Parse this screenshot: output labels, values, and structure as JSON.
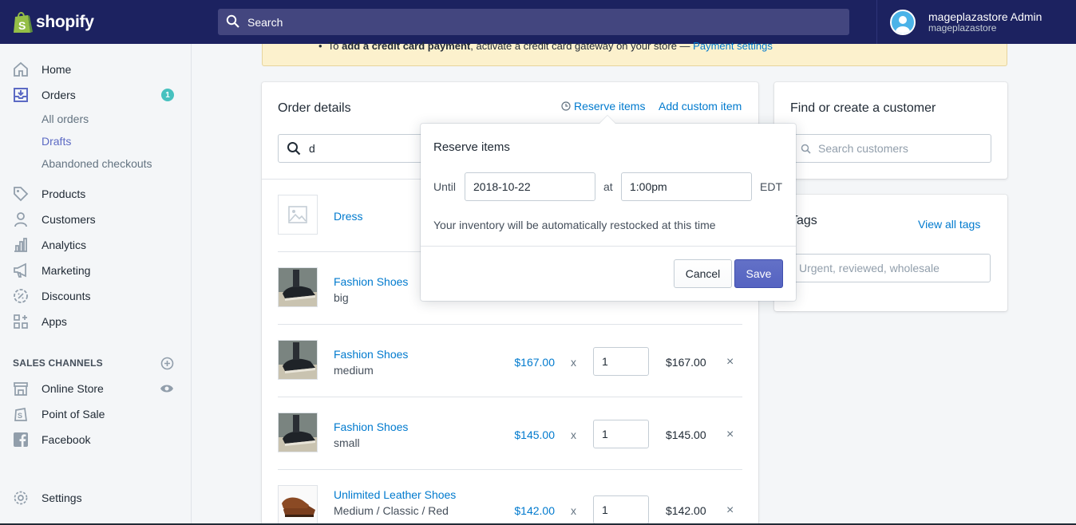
{
  "brand": {
    "logo_text": "shopify"
  },
  "topbar": {
    "search_label": "Search",
    "user_name": "mageplazastore Admin",
    "user_store": "mageplazastore"
  },
  "sidebar": {
    "items": [
      {
        "label": "Home",
        "icon": "home-icon"
      },
      {
        "label": "Orders",
        "icon": "orders-icon",
        "badge": "1"
      },
      {
        "label": "Products",
        "icon": "tag-icon"
      },
      {
        "label": "Customers",
        "icon": "person-icon"
      },
      {
        "label": "Analytics",
        "icon": "bar-chart-icon"
      },
      {
        "label": "Marketing",
        "icon": "megaphone-icon"
      },
      {
        "label": "Discounts",
        "icon": "discount-icon"
      },
      {
        "label": "Apps",
        "icon": "apps-icon"
      }
    ],
    "order_sub_items": [
      "All orders",
      "Drafts",
      "Abandoned checkouts"
    ],
    "sales_channels_heading": "SALES CHANNELS",
    "channels": [
      {
        "label": "Online Store",
        "icon": "store-icon"
      },
      {
        "label": "Point of Sale",
        "icon": "pos-icon"
      },
      {
        "label": "Facebook",
        "icon": "facebook-icon"
      }
    ],
    "settings_label": "Settings"
  },
  "banner": {
    "prefix": "To ",
    "bold": "add a credit card payment",
    "middle": ", activate a credit card gateway on your store — ",
    "link": "Payment settings"
  },
  "order_details": {
    "title": "Order details",
    "reserve_link": "Reserve items",
    "custom_link": "Add custom item",
    "search_value": "d",
    "line_items": [
      {
        "name": "Dress",
        "variant": "",
        "price": "",
        "qty": "",
        "total": ""
      },
      {
        "name": "Fashion Shoes",
        "variant": "big",
        "price": "",
        "qty": "",
        "total": ""
      },
      {
        "name": "Fashion Shoes",
        "variant": "medium",
        "price": "$167.00",
        "qty": "1",
        "total": "$167.00"
      },
      {
        "name": "Fashion Shoes",
        "variant": "small",
        "price": "$145.00",
        "qty": "1",
        "total": "$145.00"
      },
      {
        "name": "Unlimited Leather Shoes",
        "variant": "Medium / Classic / Red",
        "price": "$142.00",
        "qty": "1",
        "total": "$142.00"
      }
    ],
    "multiply_sign": "x",
    "remove_sign": "×"
  },
  "customer": {
    "title": "Find or create a customer",
    "search_placeholder": "Search customers"
  },
  "tags": {
    "title": "Tags",
    "view_all": "View all tags",
    "placeholder": "Urgent, reviewed, wholesale"
  },
  "reserve_popover": {
    "title": "Reserve items",
    "until_label": "Until",
    "date_value": "2018-10-22",
    "at_label": "at",
    "time_value": "1:00pm",
    "timezone": "EDT",
    "help": "Your inventory will be automatically restocked at this time",
    "cancel_label": "Cancel",
    "save_label": "Save"
  },
  "colors": {
    "topbar": "#1c2260",
    "accent": "#5c6ac4",
    "link": "#007ace",
    "badge": "#47c1bf"
  }
}
